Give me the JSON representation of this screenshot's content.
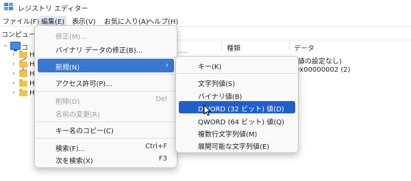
{
  "window": {
    "title": "レジストリ エディター"
  },
  "menubar": [
    "ファイル(F)",
    "編集(E)",
    "表示(V)",
    "お気に入り(A)",
    "ヘルプ(H)"
  ],
  "address": "コンピューター",
  "tree": {
    "root": "コンピ",
    "items": [
      "H",
      "H",
      "H",
      "H",
      "H"
    ]
  },
  "columns": {
    "type": "種類",
    "data": "データ"
  },
  "values": {
    "row1_data": "(値の設定なし)",
    "row2_data": "0x00000002 (2)"
  },
  "edit_menu": {
    "modify": "修正(M)...",
    "modify_binary": "バイナリ データの修正(B)...",
    "new": "新規(N)",
    "permissions": "アクセス許可(P)...",
    "delete": "削除(D)",
    "delete_shortcut": "Del",
    "rename": "名前の変更(R)",
    "copy_key_name": "キー名のコピー(C)",
    "find": "検索(F)...",
    "find_shortcut": "Ctrl+F",
    "find_next": "次を検索(X)",
    "find_next_shortcut": "F3"
  },
  "new_submenu": {
    "key": "キー(K)",
    "string": "文字列値(S)",
    "binary": "バイナリ値(B)",
    "dword": "DWORD (32 ビット) 値(D)",
    "qword": "QWORD (64 ビット) 値(Q)",
    "multi_string": "複数行文字列値(M)",
    "expandable_string": "展開可能な文字列値(E)"
  },
  "colors": {
    "highlight": "#3878d0",
    "highlight_selected": "#1f5fcc",
    "folder": "#f2c14e"
  }
}
